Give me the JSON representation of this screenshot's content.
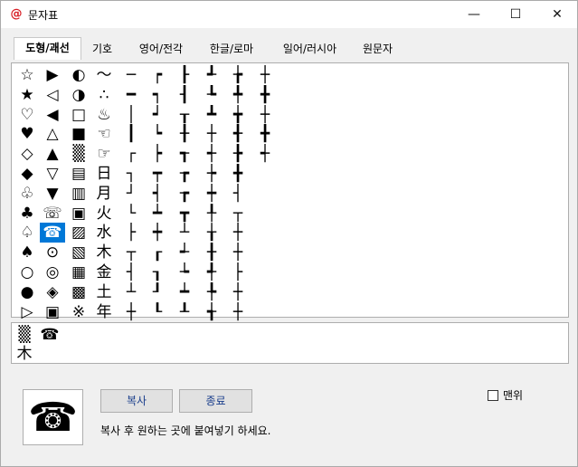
{
  "window": {
    "title": "문자표",
    "app_icon": "@"
  },
  "controls": {
    "minimize": "—",
    "maximize": "☐",
    "close": "✕"
  },
  "tabs": [
    {
      "label": "도형/괘선",
      "active": true
    },
    {
      "label": "기호",
      "active": false
    },
    {
      "label": "영어/전각",
      "active": false
    },
    {
      "label": "한글/로마",
      "active": false
    },
    {
      "label": "일어/러시아",
      "active": false
    },
    {
      "label": "원문자",
      "active": false
    }
  ],
  "grid": {
    "columns": [
      [
        "☆",
        "★",
        "♡",
        "♥",
        "◇",
        "◆",
        "♧",
        "♣",
        "♤",
        "♠",
        "○",
        "●",
        "▷"
      ],
      [
        "▶",
        "◁",
        "◀",
        "△",
        "▲",
        "▽",
        "▼",
        "☏",
        "☎",
        "⊙",
        "◎",
        "◈",
        "▣"
      ],
      [
        "◐",
        "◑",
        "□",
        "■",
        "▒",
        "▤",
        "▥",
        "▣",
        "▨",
        "▧",
        "▦",
        "▩",
        "※"
      ],
      [
        "～",
        "∴",
        "♨",
        "☜",
        "☞",
        "日",
        "月",
        "火",
        "水",
        "木",
        "金",
        "土",
        "年"
      ],
      [
        "─",
        "━",
        "│",
        "┃",
        "┌",
        "┐",
        "┘",
        "└",
        "├",
        "┬",
        "┤",
        "┴",
        "┼"
      ],
      [
        "┍",
        "┑",
        "┙",
        "┕",
        "┝",
        "┯",
        "┥",
        "┷",
        "┿",
        "┎",
        "┒",
        "┚",
        "┖"
      ],
      [
        "┠",
        "┨",
        "┰",
        "╂",
        "┱",
        "┲",
        "┲",
        "┳",
        "┴",
        "┵",
        "┶",
        "┷",
        "┸"
      ],
      [
        "┹",
        "┺",
        "┻",
        "┼",
        "┽",
        "┾",
        "┿",
        "╀",
        "╁",
        "╂",
        "╃",
        "╄",
        "╅"
      ],
      [
        "╆",
        "╇",
        "╈",
        "╉",
        "╊",
        "╋",
        "┤",
        "┬",
        "┼",
        "┼",
        "├",
        "┼",
        "┼"
      ],
      [
        "┼",
        "╋",
        "┼",
        "╋",
        "┽",
        "",
        "",
        "",
        "",
        "",
        "",
        "",
        ""
      ]
    ],
    "selected": {
      "col": 1,
      "row": 8
    }
  },
  "preview_chars": [
    "▒",
    "☎",
    "木"
  ],
  "big_preview": "☎",
  "buttons": {
    "copy": "복사",
    "close": "종료"
  },
  "hint": "복사 후 원하는 곳에 붙여넣기 하세요.",
  "checkbox": {
    "label": "맨위",
    "checked": false
  }
}
